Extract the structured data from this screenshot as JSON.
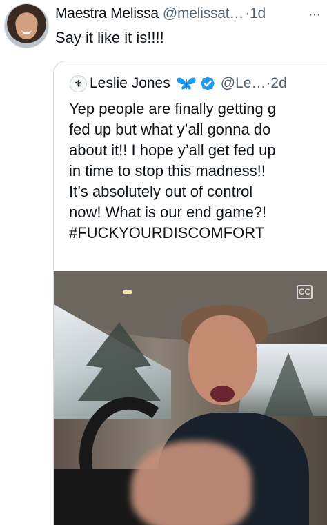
{
  "post": {
    "author_name": "Maestra Melissa",
    "author_handle": "@melissat…",
    "time": "·1d",
    "more": "···",
    "text": "Say it like it is!!!!"
  },
  "quoted_post": {
    "avatar_text": "⚜",
    "author_name": "Leslie Jones",
    "author_handle": "@Le…",
    "time": "·2d",
    "text": "Yep people are finally getting g\nfed up but what y’all gonna do\nabout it!! I hope y’all get fed up\nin time to stop this madness!!\nIt’s absolutely out of control\nnow! What is our end game?!\n#FUCKYOURDISCOMFORT",
    "media": {
      "caption_icon": "closed-captions-icon",
      "caption_icon_text": "CC"
    }
  },
  "icons": {
    "more": "more-options-icon",
    "butterfly": "butterfly-icon",
    "verified": "verified-badge-icon"
  },
  "colors": {
    "text": "#0f1419",
    "muted": "#536471",
    "border": "#cfd9de",
    "verified": "#1d9bf0"
  }
}
